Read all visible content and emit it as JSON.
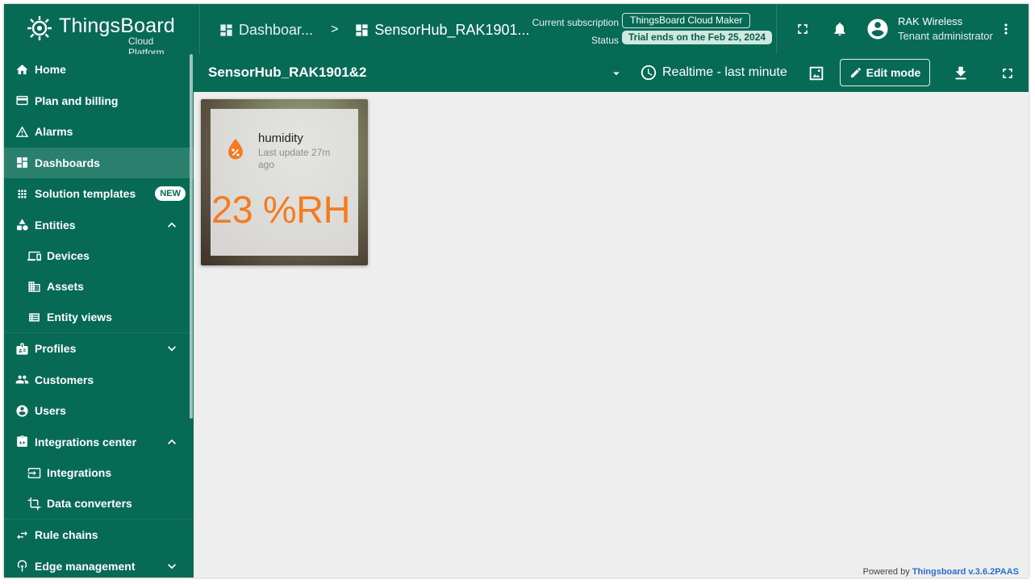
{
  "brand": {
    "name": "ThingsBoard",
    "subtitle": "Cloud Platform"
  },
  "breadcrumb": {
    "items": [
      "Dashboar...",
      "SensorHub_RAK1901..."
    ],
    "separator": ">"
  },
  "subscription": {
    "label": "Current subscription",
    "plan": "ThingsBoard Cloud Maker",
    "status_label": "Status",
    "status_value": "Trial ends on the Feb 25, 2024"
  },
  "user": {
    "name": "RAK Wireless",
    "role": "Tenant administrator"
  },
  "sidebar": {
    "items": [
      {
        "label": "Home",
        "icon": "home-icon"
      },
      {
        "label": "Plan and billing",
        "icon": "billing-icon"
      },
      {
        "label": "Alarms",
        "icon": "warning-icon"
      },
      {
        "label": "Dashboards",
        "icon": "dashboard-icon",
        "active": true
      },
      {
        "label": "Solution templates",
        "icon": "grid-icon",
        "badge": "NEW"
      },
      {
        "label": "Entities",
        "icon": "entities-icon",
        "expanded": true
      },
      {
        "label": "Devices",
        "icon": "devices-icon",
        "sub": true
      },
      {
        "label": "Assets",
        "icon": "assets-icon",
        "sub": true
      },
      {
        "label": "Entity views",
        "icon": "entity-views-icon",
        "sub": true
      },
      {
        "label": "Profiles",
        "icon": "profiles-icon",
        "expanded": false
      },
      {
        "label": "Customers",
        "icon": "customers-icon"
      },
      {
        "label": "Users",
        "icon": "users-icon"
      },
      {
        "label": "Integrations center",
        "icon": "integrations-center-icon",
        "expanded": true
      },
      {
        "label": "Integrations",
        "icon": "integrations-icon",
        "sub": true
      },
      {
        "label": "Data converters",
        "icon": "converter-icon",
        "sub": true
      },
      {
        "label": "Rule chains",
        "icon": "rule-chains-icon"
      },
      {
        "label": "Edge management",
        "icon": "edge-icon",
        "expanded": false
      }
    ]
  },
  "dashboard": {
    "title": "SensorHub_RAK1901&2",
    "timewindow": "Realtime - last minute",
    "edit_label": "Edit mode"
  },
  "widget": {
    "title": "humidity",
    "last_update": "Last update 27m ago",
    "value": "23 %RH",
    "value_color": "#f47b20"
  },
  "footer": {
    "prefix": "Powered by",
    "link": "Thingsboard v.3.6.2PAAS"
  },
  "colors": {
    "primary": "#076a55",
    "active": "#2a806d",
    "accent": "#f47b20"
  }
}
